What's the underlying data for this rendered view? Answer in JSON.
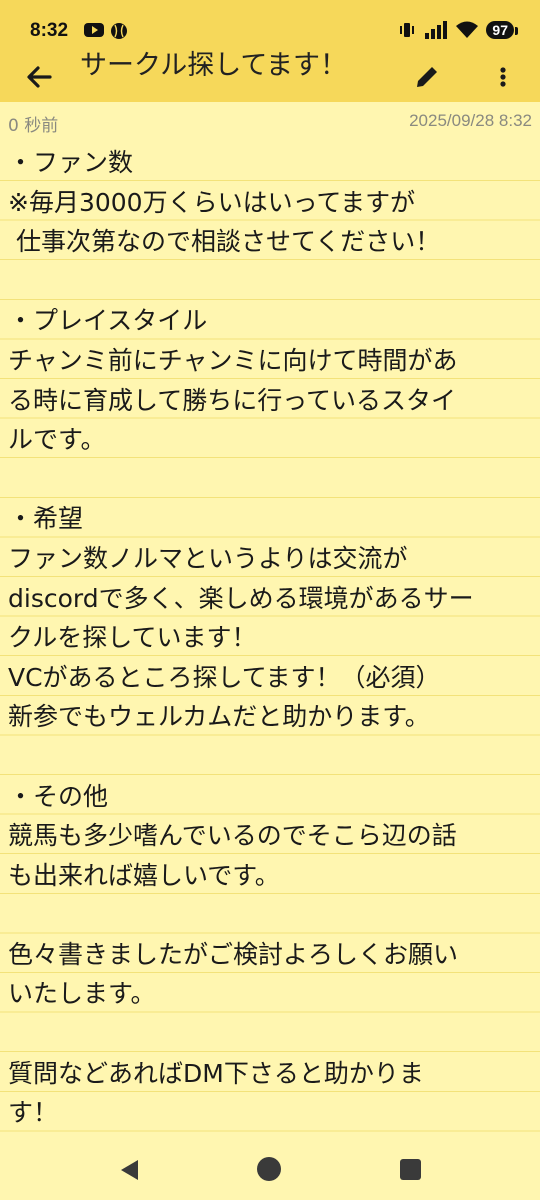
{
  "status_bar": {
    "time": "8:32",
    "battery": "97"
  },
  "app_bar": {
    "title": "サークル探してます！"
  },
  "meta": {
    "relative_time": "0 秒前",
    "timestamp": "2025/09/28 8:32"
  },
  "note": {
    "lines": [
      "・ファン数",
      "※毎月3000万くらいはいってますが",
      " 仕事次第なので相談させてください！",
      "",
      "・プレイスタイル",
      "チャンミ前にチャンミに向けて時間があ",
      "る時に育成して勝ちに行っているスタイ",
      "ルです。",
      "",
      "・希望",
      "ファン数ノルマというよりは交流が",
      "discordで多く、楽しめる環境があるサー",
      "クルを探しています！",
      "VCがあるところ探してます！（必須）",
      "新参でもウェルカムだと助かります。",
      "",
      "・その他",
      "競馬も多少嗜んでいるのでそこら辺の話",
      "も出来れば嬉しいです。",
      "",
      "色々書きましたがご検討よろしくお願い",
      "いたします。",
      "",
      "質問などあればDM下さると助かりま",
      "す！"
    ]
  },
  "colors": {
    "app_bar": "#F6D85A",
    "note_background": "#FFF6B0",
    "rule_line": "#F3E27A"
  }
}
